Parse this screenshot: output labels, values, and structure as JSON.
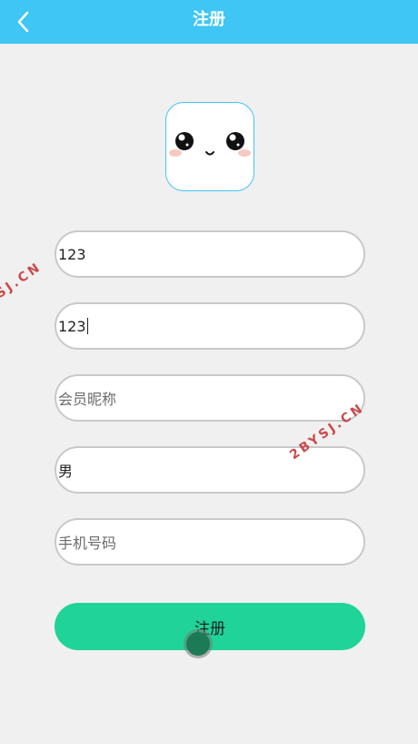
{
  "header": {
    "title": "注册",
    "back_icon": "chevron-left-icon",
    "background": "#3fc6f4"
  },
  "avatar": {
    "icon": "kawaii-face-icon"
  },
  "form": {
    "account": {
      "value": "123"
    },
    "password": {
      "value": "123"
    },
    "nickname": {
      "placeholder": "会员昵称"
    },
    "gender": {
      "value": "男"
    },
    "phone": {
      "placeholder": "手机号码"
    }
  },
  "submit": {
    "label": "注册",
    "color": "#20d398"
  },
  "watermarks": [
    "SJ.CN",
    "2BYSJ.CN"
  ]
}
